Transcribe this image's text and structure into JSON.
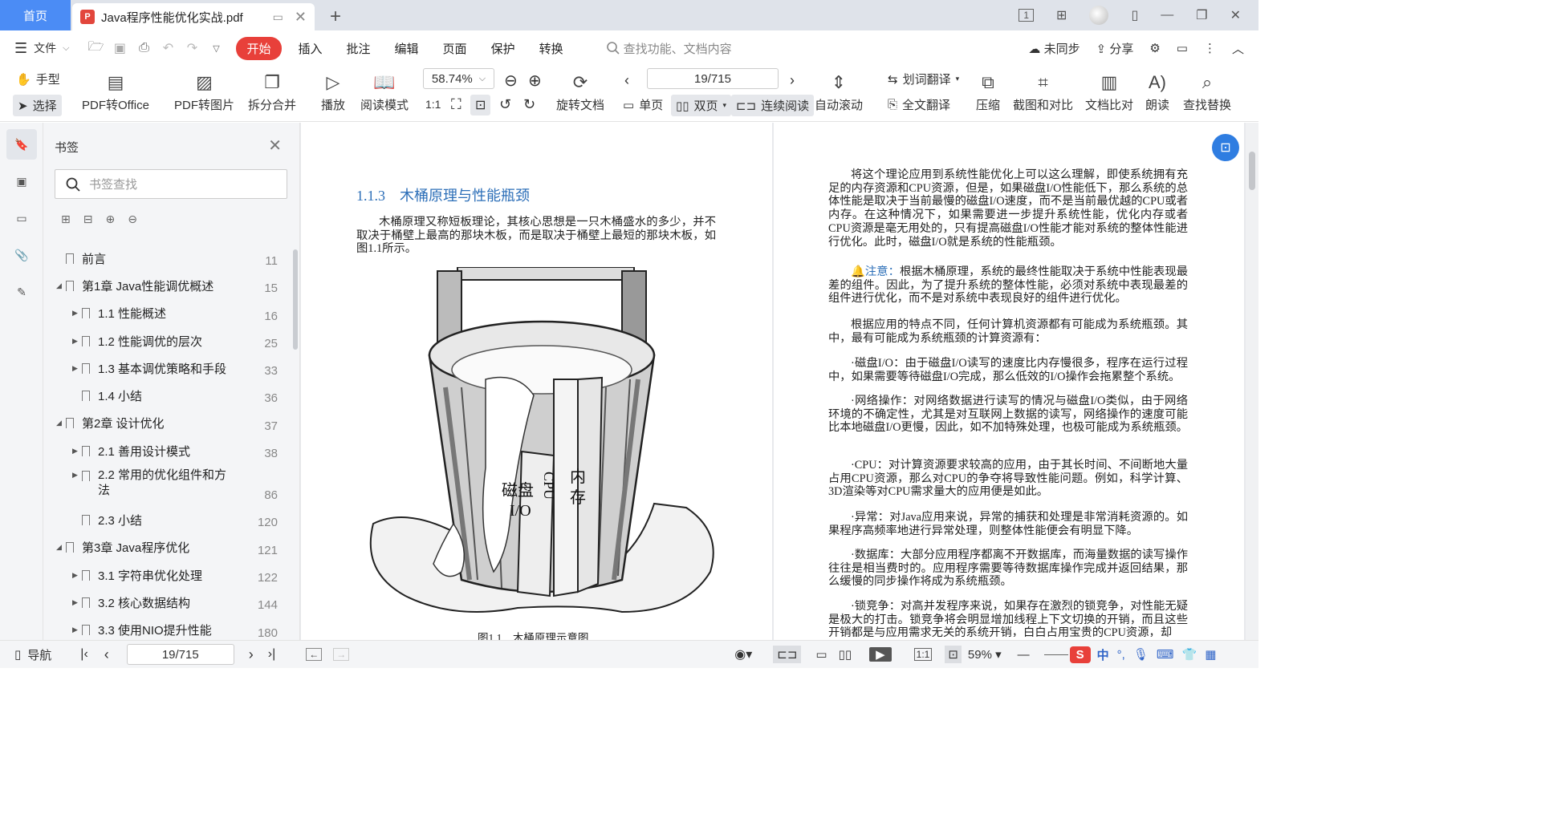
{
  "tabs": {
    "home": "首页",
    "doc_title": "Java程序性能优化实战.pdf"
  },
  "title_right": {
    "page_indicator": "1"
  },
  "menu": {
    "file": "文件",
    "start": "开始",
    "items": [
      "插入",
      "批注",
      "编辑",
      "页面",
      "保护",
      "转换"
    ],
    "search_placeholder": "查找功能、文档内容",
    "sync": "未同步",
    "share": "分享"
  },
  "toolbar": {
    "hand": "手型",
    "select": "选择",
    "pdf_to_office": "PDF转Office",
    "pdf_to_image": "PDF转图片",
    "split_merge": "拆分合并",
    "play": "播放",
    "read_mode": "阅读模式",
    "zoom": "58.74%",
    "rotate_doc": "旋转文档",
    "page_input": "19/715",
    "single": "单页",
    "double": "双页",
    "continuous": "连续阅读",
    "auto_scroll": "自动滚动",
    "word_translate": "划词翻译",
    "full_translate": "全文翻译",
    "compress": "压缩",
    "screenshot_compare": "截图和对比",
    "doc_compare": "文档比对",
    "read_aloud": "朗读",
    "find_replace": "查找替换"
  },
  "bookmarks": {
    "title": "书签",
    "search_placeholder": "书签查找",
    "items": [
      {
        "label": "前言",
        "page": "11"
      },
      {
        "label": "第1章 Java性能调优概述",
        "page": "15"
      },
      {
        "label": "1.1 性能概述",
        "page": "16"
      },
      {
        "label": "1.2 性能调优的层次",
        "page": "25"
      },
      {
        "label": "1.3 基本调优策略和手段",
        "page": "33"
      },
      {
        "label": "1.4 小结",
        "page": "36"
      },
      {
        "label": "第2章 设计优化",
        "page": "37"
      },
      {
        "label": "2.1 善用设计模式",
        "page": "38"
      },
      {
        "label": "2.2 常用的优化组件和方",
        "label2": "法",
        "page": "86"
      },
      {
        "label": "2.3 小结",
        "page": "120"
      },
      {
        "label": "第3章 Java程序优化",
        "page": "121"
      },
      {
        "label": "3.1 字符串优化处理",
        "page": "122"
      },
      {
        "label": "3.2 核心数据结构",
        "page": "144"
      },
      {
        "label": "3.3 使用NIO提升性能",
        "page": "180"
      }
    ]
  },
  "page_left": {
    "heading": "1.1.3　木桶原理与性能瓶颈",
    "para": "木桶原理又称短板理论，其核心思想是一只木桶盛水的多少，并不取决于桶壁上最高的那块木板，而是取决于桶壁上最短的那块木板，如图1.1所示。",
    "fig_labels": {
      "disk": "磁盘",
      "io": "I/O",
      "cpu": "CPU",
      "mem1": "内",
      "mem2": "存"
    },
    "caption": "图1.1　木桶原理示意图"
  },
  "page_right": {
    "p1": "将这个理论应用到系统性能优化上可以这么理解，即使系统拥有充足的内存资源和CPU资源，但是，如果磁盘I/O性能低下，那么系统的总体性能是取决于当前最慢的磁盘I/O速度，而不是当前最优越的CPU或者内存。在这种情况下，如果需要进一步提升系统性能，优化内存或者CPU资源是毫无用处的，只有提高磁盘I/O性能才能对系统的整体性能进行优化。此时，磁盘I/O就是系统的性能瓶颈。",
    "note_label": "注意：",
    "note": "根据木桶原理，系统的最终性能取决于系统中性能表现最差的组件。因此，为了提升系统的整体性能，必须对系统中表现最差的组件进行优化，而不是对系统中表现良好的组件进行优化。",
    "p2": "根据应用的特点不同，任何计算机资源都有可能成为系统瓶颈。其中，最有可能成为系统瓶颈的计算资源有：",
    "p3": "·磁盘I/O：由于磁盘I/O读写的速度比内存慢很多，程序在运行过程中，如果需要等待磁盘I/O完成，那么低效的I/O操作会拖累整个系统。",
    "p4": "·网络操作：对网络数据进行读写的情况与磁盘I/O类似，由于网络环境的不确定性，尤其是对互联网上数据的读写，网络操作的速度可能比本地磁盘I/O更慢，因此，如不加特殊处理，也极可能成为系统瓶颈。",
    "p5": "·CPU：对计算资源要求较高的应用，由于其长时间、不间断地大量占用CPU资源，那么对CPU的争夺将导致性能问题。例如，科学计算、3D渲染等对CPU需求量大的应用便是如此。",
    "p6": "·异常：对Java应用来说，异常的捕获和处理是非常消耗资源的。如果程序高频率地进行异常处理，则整体性能便会有明显下降。",
    "p7": "·数据库：大部分应用程序都离不开数据库，而海量数据的读写操作往往是相当费时的。应用程序需要等待数据库操作完成并返回结果，那么缓慢的同步操作将成为系统瓶颈。",
    "p8": "·锁竞争：对高并发程序来说，如果存在激烈的锁竞争，对性能无疑是极大的打击。锁竞争将会明显增加线程上下文切换的开销，而且这些开销都是与应用需求无关的系统开销，白白占用宝贵的CPU资源，却"
  },
  "status": {
    "nav": "导航",
    "page": "19/715",
    "zoom": "59%",
    "ime": "中"
  }
}
